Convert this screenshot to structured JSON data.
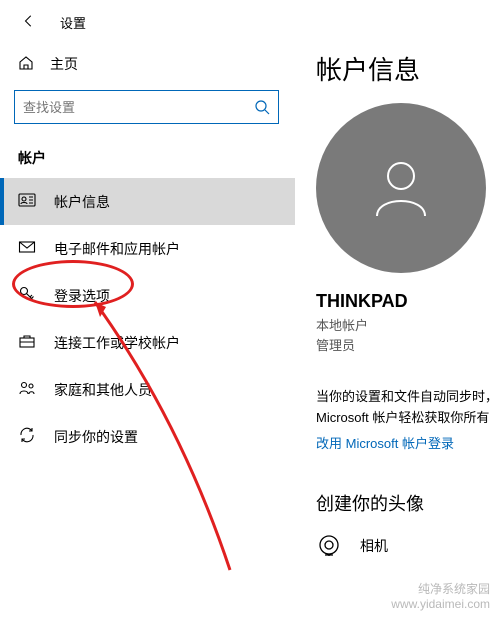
{
  "header": {
    "title": "设置"
  },
  "home_label": "主页",
  "search": {
    "placeholder": "查找设置"
  },
  "section_label": "帐户",
  "nav": [
    {
      "label": "帐户信息"
    },
    {
      "label": "电子邮件和应用帐户"
    },
    {
      "label": "登录选项"
    },
    {
      "label": "连接工作或学校帐户"
    },
    {
      "label": "家庭和其他人员"
    },
    {
      "label": "同步你的设置"
    }
  ],
  "detail": {
    "title": "帐户信息",
    "username": "THINKPAD",
    "subtype": "本地帐户",
    "role": "管理员",
    "desc_line1": "当你的设置和文件自动同步时，",
    "desc_line2": "Microsoft 帐户轻松获取你所有",
    "link": "改用 Microsoft 帐户登录",
    "avatar_section_title": "创建你的头像",
    "camera_label": "相机"
  },
  "watermark": {
    "line1": "纯净系统家园",
    "line2": "www.yidaimei.com"
  }
}
